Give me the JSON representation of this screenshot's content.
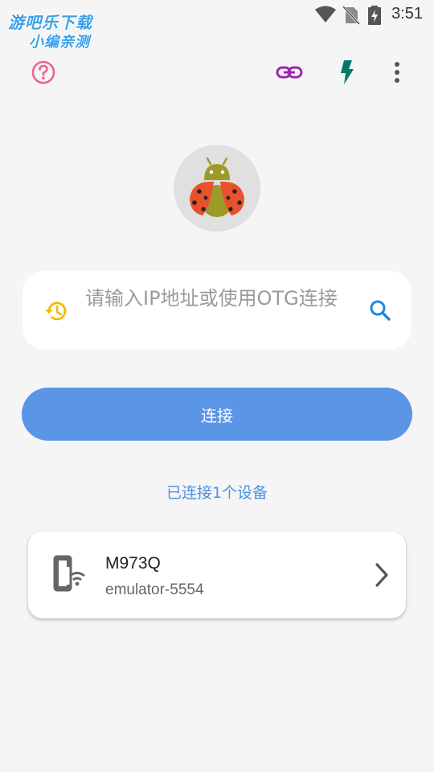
{
  "status_bar": {
    "time": "3:51",
    "icons": [
      "wifi-icon",
      "no-sim-icon",
      "battery-charging-icon"
    ]
  },
  "watermark": {
    "line1": "游吧乐下载",
    "line2": "小编亲测"
  },
  "toolbar": {
    "icons": [
      "help-icon",
      "link-icon",
      "flash-icon",
      "more-vert-icon"
    ],
    "colors": {
      "help": "#f06292",
      "link": "#9c27b0",
      "flash": "#00796b",
      "more": "#555555"
    }
  },
  "logo": {
    "icon": "ladybug-android-logo"
  },
  "search": {
    "placeholder": "请输入IP地址或使用OTG连接",
    "history_icon_color": "#f5b800",
    "search_icon_color": "#1e88e5"
  },
  "connect_button": {
    "label": "连接",
    "color": "#5b95e6"
  },
  "connected_status": "已连接1个设备",
  "devices": [
    {
      "name": "M973Q",
      "serial": "emulator-5554"
    }
  ]
}
